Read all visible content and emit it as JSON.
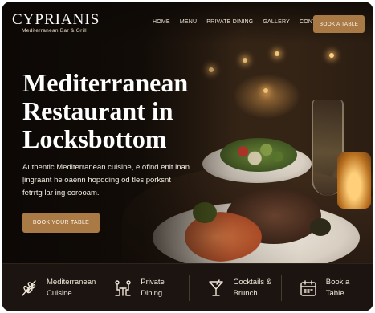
{
  "brand": {
    "name": "CYPRIANIS",
    "tagline": "Mediterranean Bar & Grill"
  },
  "nav": {
    "items": [
      "HOME",
      "MENU",
      "PRIVATE DINING",
      "GALLERY",
      "CONTACT"
    ],
    "cta_label": "BOOK A TABLE"
  },
  "hero": {
    "title": "Mediterranean Restaurant in Locksbottom",
    "description": "Authentic Mediterranean cuisine, e ofind enlt inan ļingraant he oaenn hopdding od tles porksnt fetrrtg lar ing corooam.",
    "cta_label": "BOOK YOUR TABLE"
  },
  "features": [
    {
      "icon": "olive-branch-icon",
      "label": "Mediterranean\nCuisine"
    },
    {
      "icon": "dining-table-icon",
      "label": "Private\nDining"
    },
    {
      "icon": "cocktail-icon",
      "label": "Cocktails &\nBrunch"
    },
    {
      "icon": "calendar-icon",
      "label": "Book a\nTable"
    }
  ],
  "colors": {
    "accent": "#a97a45",
    "background": "#1b1410",
    "text": "#ffffff"
  }
}
